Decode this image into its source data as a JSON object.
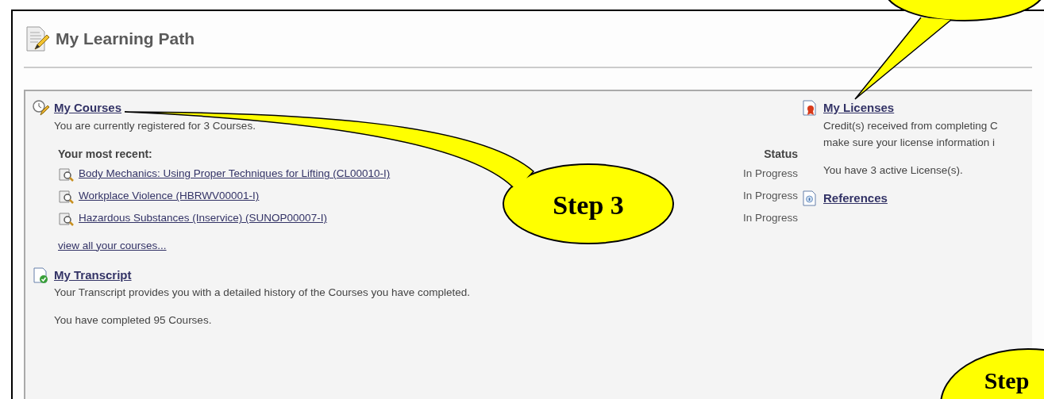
{
  "page": {
    "title": "My Learning Path"
  },
  "courses": {
    "title": "My Courses",
    "summary": "You are currently registered for 3 Courses.",
    "recent_label": "Your most recent:",
    "status_label": "Status",
    "items": [
      {
        "name": "Body Mechanics: Using Proper Techniques for Lifting (CL00010-I)",
        "status": "In Progress"
      },
      {
        "name": "Workplace Violence (HBRWV00001-I)",
        "status": "In Progress"
      },
      {
        "name": "Hazardous Substances (Inservice) (SUNOP00007-I)",
        "status": "In Progress"
      }
    ],
    "view_all": "view all your courses..."
  },
  "transcript": {
    "title": "My Transcript",
    "summary": "Your Transcript provides you with a detailed history of the Courses you have completed.",
    "count": "You have completed 95 Courses."
  },
  "licenses": {
    "title": "My Licenses",
    "summary_lines": [
      "Credit(s) received from completing C",
      "make sure your license information i"
    ],
    "count": "You have 3 active License(s)."
  },
  "references": {
    "title": "References"
  },
  "callouts": [
    {
      "kind": "pointer",
      "text": "Step 3"
    },
    {
      "kind": "pointer"
    },
    {
      "kind": "plain",
      "text": "Step"
    }
  ]
}
